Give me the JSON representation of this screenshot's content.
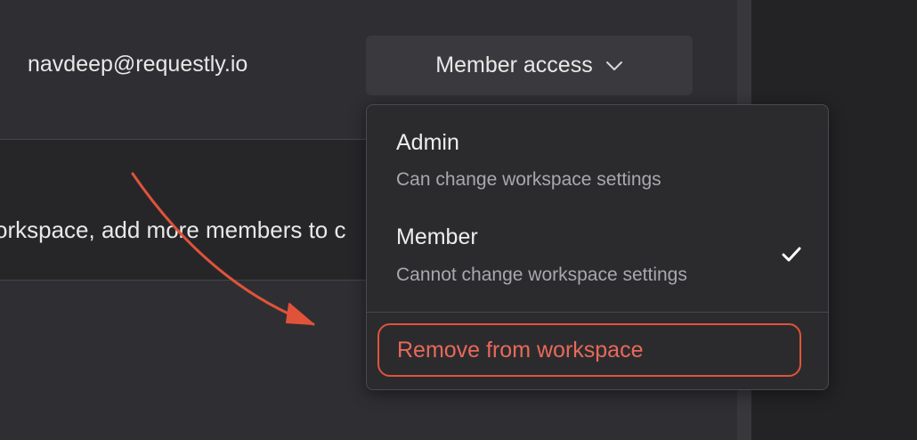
{
  "member": {
    "email": "navdeep@requestly.io",
    "access_button_label": "Member access"
  },
  "banner": {
    "text": "orkspace, add more members to c"
  },
  "dropdown": {
    "options": [
      {
        "title": "Admin",
        "description": "Can change workspace settings",
        "selected": false
      },
      {
        "title": "Member",
        "description": "Cannot change workspace settings",
        "selected": true
      }
    ],
    "remove_label": "Remove from workspace"
  },
  "icons": {
    "access_chevron": "chevron-down-icon",
    "selected_check": "check-icon"
  },
  "colors": {
    "annotation": "#e0533a",
    "danger_text": "#e8695a",
    "background": "#2f2f33"
  }
}
